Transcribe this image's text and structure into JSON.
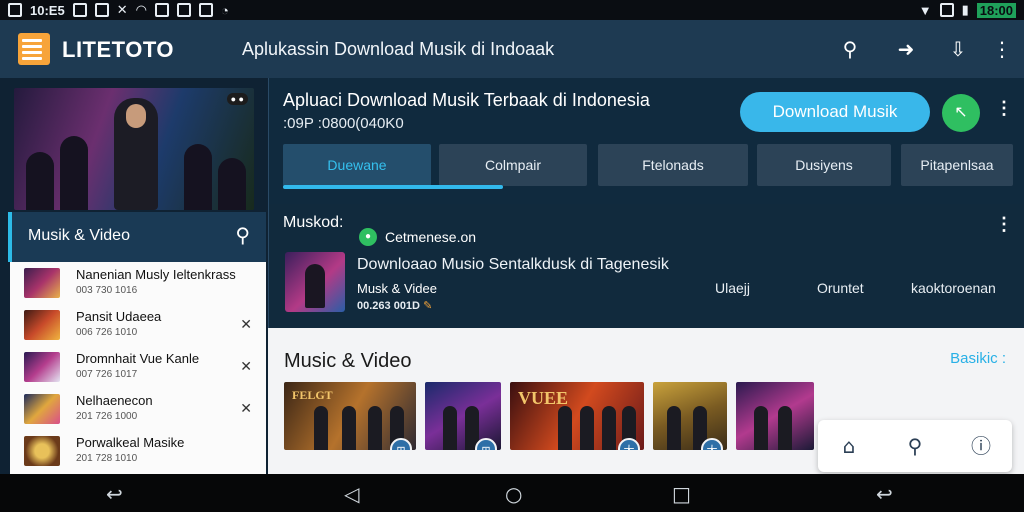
{
  "status_bar": {
    "time_left": "10:E5",
    "time_right": "18:00"
  },
  "header": {
    "brand": "LITETOTO",
    "title": "Aplukassin Download Musik di Indoaak",
    "icons": [
      "search-icon",
      "share-icon",
      "download-icon",
      "more-icon"
    ]
  },
  "sidebar": {
    "cover_badge": "● ●",
    "tab_label": "Musik & Video",
    "items": [
      {
        "title": "Nanenian Musly Ieltenkrass",
        "sub": "003 730 1016",
        "close": ""
      },
      {
        "title": "Pansit Udaeea",
        "sub": "006 726 1010",
        "close": "✕"
      },
      {
        "title": "Dromnhait Vue Kanle",
        "sub": "007 726 1017",
        "close": "✕"
      },
      {
        "title": "Nelhaenecon",
        "sub": "201 726 1000",
        "close": "✕"
      },
      {
        "title": "Porwalkeal Masike",
        "sub": "201 728 1010",
        "close": ""
      }
    ]
  },
  "main": {
    "title": "Apluaci Download Musik Terbaak  di Indonesia",
    "subtitle": ":09P :0800(040K0",
    "download_button": "Download Musik",
    "go_button": "↖",
    "tabs": [
      "Duewane",
      "Colmpair",
      "Ftelonads",
      "Dusiyens",
      "Pitapenlsaa"
    ]
  },
  "feature": {
    "heading": "Muskod:",
    "channel": "Cetmenese.on",
    "title": "Downloaao Musio Sentalkdusk di Tagenesik",
    "category": "Musk & Videe",
    "meta": "00.263 001D",
    "meta_icon": "✎",
    "cols": [
      "Ulaejj",
      "Oruntet",
      "kaoktoroenan"
    ]
  },
  "section": {
    "title": "Music & Video",
    "link": "Basikic :",
    "cards": [
      {
        "caption": "FELGT",
        "badge": "⊞"
      },
      {
        "caption": "",
        "badge": "⊞"
      },
      {
        "caption": "VUEE",
        "badge": "大"
      },
      {
        "caption": "",
        "badge": "大"
      },
      {
        "caption": "",
        "badge": ""
      }
    ]
  },
  "floating_bar": {
    "icons": [
      "home-icon",
      "search-icon",
      "info-icon"
    ]
  },
  "colors": {
    "accent": "#39b7ea",
    "go": "#2fbf61",
    "header": "#1e3a52",
    "logo": "#f7a43a"
  }
}
